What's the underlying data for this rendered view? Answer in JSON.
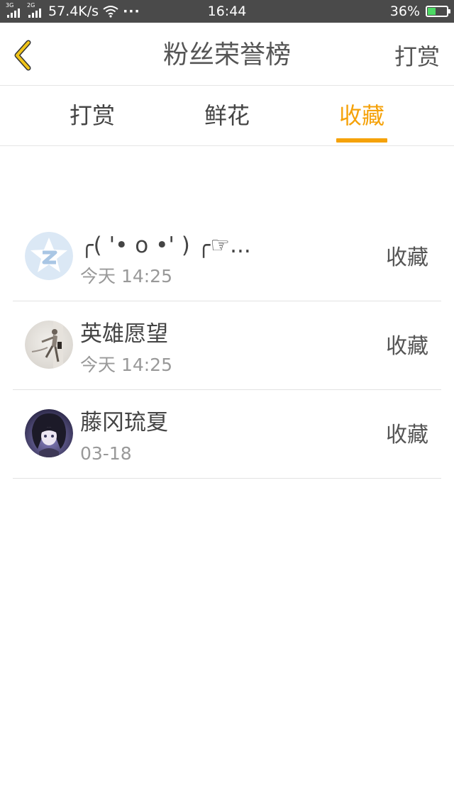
{
  "status_bar": {
    "network_1": "3G",
    "network_2": "2G",
    "speed": "57.4K/s",
    "more": "···",
    "time": "16:44",
    "battery": "36%",
    "battery_color": "#4cd964"
  },
  "nav": {
    "back_icon": "chevron-left-icon",
    "title": "粉丝荣誉榜",
    "action": "打赏",
    "back_color": "#f0c419"
  },
  "tabs": [
    {
      "label": "打赏",
      "active": false
    },
    {
      "label": "鲜花",
      "active": false
    },
    {
      "label": "收藏",
      "active": true
    }
  ],
  "accent_color": "#f5a20a",
  "list": [
    {
      "name": "╭( '• o •' ) ╭☞...",
      "time": "今天 14:25",
      "action": "收藏",
      "avatar": "qq-zone-icon"
    },
    {
      "name": "英雄愿望",
      "time": "今天 14:25",
      "action": "收藏",
      "avatar": "user-photo"
    },
    {
      "name": "藤冈琉夏",
      "time": "03-18",
      "action": "收藏",
      "avatar": "anime-avatar"
    }
  ]
}
